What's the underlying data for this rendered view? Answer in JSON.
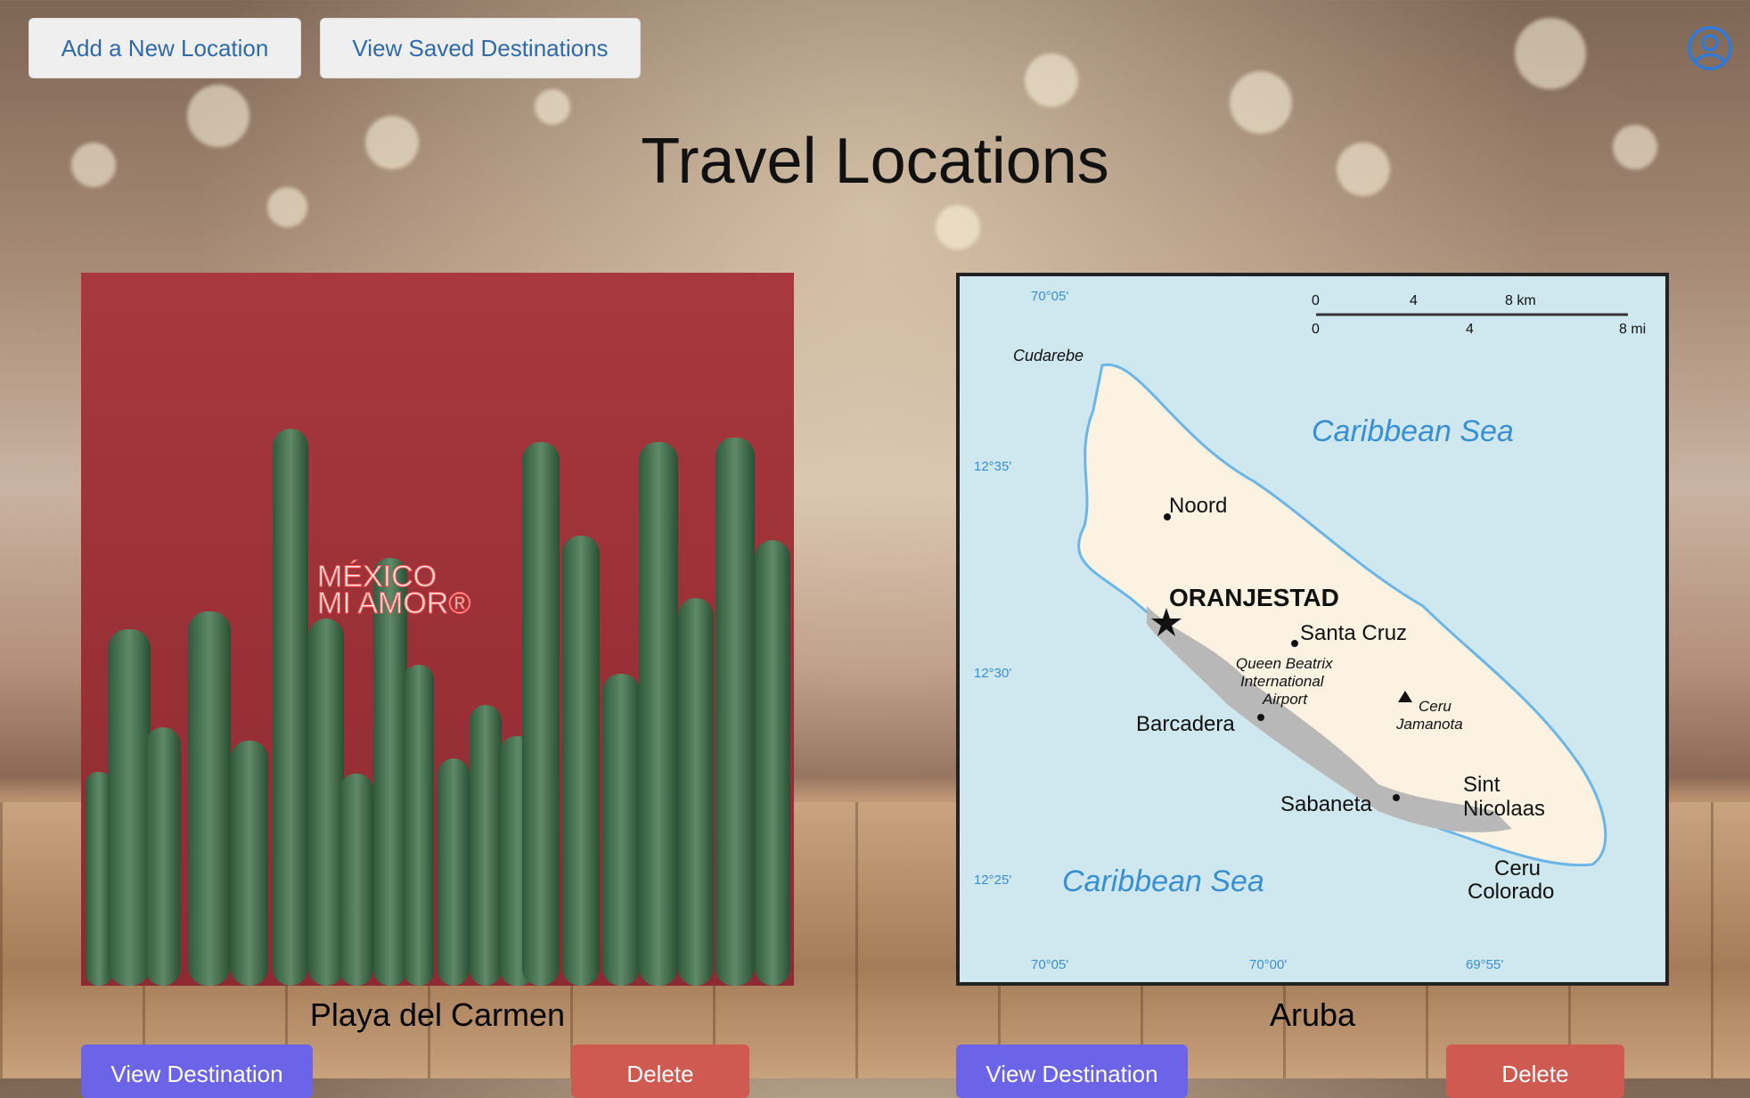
{
  "header": {
    "add_location_label": "Add a New Location",
    "saved_destinations_label": "View Saved Destinations",
    "profile_icon": "user-circle-icon"
  },
  "page": {
    "title": "Travel Locations"
  },
  "cards": [
    {
      "name": "Playa del Carmen",
      "image_text_line1": "MÉXICO",
      "image_text_line2": "MI AMOR®",
      "view_label": "View Destination",
      "delete_label": "Delete"
    },
    {
      "name": "Aruba",
      "map": {
        "sea_top": "Caribbean Sea",
        "sea_bottom": "Caribbean Sea",
        "capital": "ORANJESTAD",
        "places": [
          "Noord",
          "Santa Cruz",
          "Barcadera",
          "Sabaneta",
          "Sint",
          "Nicolaas",
          "Ceru",
          "Colorado",
          "Cudarebe"
        ],
        "airport": [
          "Queen Beatrix",
          "International",
          "Airport"
        ],
        "peak": [
          "Ceru",
          "Jamanota"
        ],
        "scale_km": [
          "0",
          "4",
          "8 km"
        ],
        "scale_mi": [
          "0",
          "4",
          "8 mi"
        ],
        "lat_labels": [
          "12°35'",
          "12°30'",
          "12°25'"
        ],
        "lon_labels": [
          "70°05'",
          "70°00'",
          "69°55'"
        ]
      },
      "view_label": "View Destination",
      "delete_label": "Delete"
    }
  ],
  "colors": {
    "view_button": "#6b64e8",
    "delete_button": "#cf5a52",
    "top_button_text": "#2f6aa8"
  }
}
